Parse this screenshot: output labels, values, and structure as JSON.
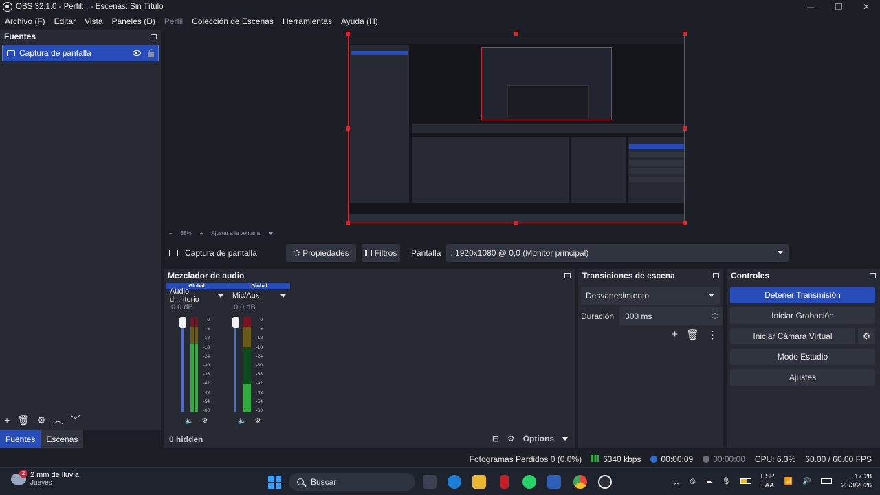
{
  "window": {
    "title": "OBS 32.1.0 - Perfil: . - Escenas: Sin Título",
    "controls": [
      "—",
      "❐",
      "✕"
    ]
  },
  "menu": [
    {
      "label": "Archivo (F)",
      "enabled": true
    },
    {
      "label": "Editar",
      "enabled": true
    },
    {
      "label": "Vista",
      "enabled": true
    },
    {
      "label": "Paneles (D)",
      "enabled": true
    },
    {
      "label": "Perfil",
      "enabled": false
    },
    {
      "label": "Colección de Escenas",
      "enabled": true
    },
    {
      "label": "Herramientas",
      "enabled": true
    },
    {
      "label": "Ayuda (H)",
      "enabled": true
    }
  ],
  "sources_dock": {
    "title": "Fuentes",
    "items": [
      {
        "label": "Captura de pantalla",
        "visible": true,
        "locked": false
      }
    ],
    "toolbar": [
      "+",
      "🗑",
      "⚙",
      "︿",
      "﹀"
    ],
    "tabs": [
      {
        "label": "Fuentes",
        "active": true
      },
      {
        "label": "Escenas",
        "active": false
      }
    ]
  },
  "preview": {
    "zoom_out": "−",
    "zoom": "38%",
    "zoom_in": "+",
    "fit": "Ajustar a la ventana"
  },
  "properties_bar": {
    "source_name": "Captura de pantalla",
    "properties_label": "Propiedades",
    "filters_label": "Filtros",
    "display_label": "Pantalla",
    "display_value": ": 1920x1080 @ 0,0 (Monitor principal)"
  },
  "mixer": {
    "title": "Mezclador de audio",
    "channels": [
      {
        "badge": "Global",
        "name": "Audio d...ritorio",
        "db": "0.0 dB",
        "level": 0.72
      },
      {
        "badge": "Global",
        "name": "Mic/Aux",
        "db": "0.0 dB",
        "level": 0.3
      }
    ],
    "ticks": [
      "0",
      "-6",
      "-12",
      "-18",
      "-24",
      "-30",
      "-36",
      "-42",
      "-48",
      "-54",
      "-60"
    ],
    "hidden": "0 hidden",
    "options": "Options"
  },
  "transitions": {
    "title": "Transiciones de escena",
    "selected": "Desvanecimiento",
    "duration_label": "Duración",
    "duration_value": "300 ms"
  },
  "controls": {
    "title": "Controles",
    "buttons": [
      {
        "label": "Detener Transmisión",
        "primary": true
      },
      {
        "label": "Iniciar Grabación",
        "primary": false
      },
      {
        "label": "Iniciar Cámara Virtual",
        "primary": false
      },
      {
        "label": "Modo Estudio",
        "primary": false
      },
      {
        "label": "Ajustes",
        "primary": false
      }
    ]
  },
  "status": {
    "dropped": "Fotogramas Perdidos 0 (0.0%)",
    "bitrate": "6340 kbps",
    "stream_time": "00:00:09",
    "rec_time": "00:00:00",
    "cpu": "CPU: 6.3%",
    "fps": "60.00 / 60.00 FPS"
  },
  "taskbar": {
    "weather_badge": "2",
    "weather_line1": "2 mm de lluvia",
    "weather_line2": "Jueves",
    "search_placeholder": "Buscar",
    "lang_line1": "ESP",
    "lang_line2": "LAA",
    "time": "17:28",
    "date": "23/3/2026"
  },
  "colors": {
    "accent": "#284cb8",
    "selection_border": "#e0242b",
    "panel": "#272a33",
    "background": "#1d1f26"
  }
}
